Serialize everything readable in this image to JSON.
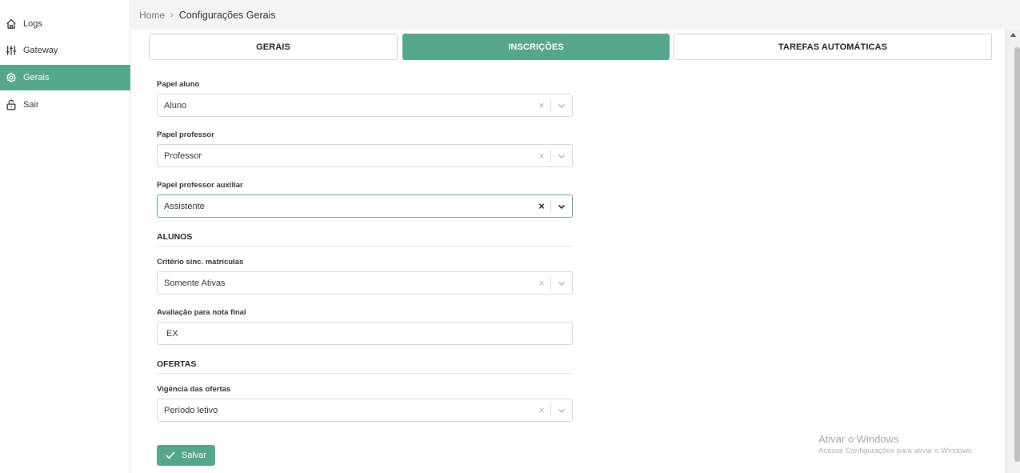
{
  "sidebar": {
    "items": [
      {
        "label": "Logs",
        "icon": "home-icon"
      },
      {
        "label": "Gateway",
        "icon": "sliders-icon"
      },
      {
        "label": "Gerais",
        "icon": "gear-icon",
        "active": true
      },
      {
        "label": "Sair",
        "icon": "lock-open-icon"
      }
    ]
  },
  "breadcrumb": {
    "home": "Home",
    "separator": "›",
    "current": "Configurações Gerais"
  },
  "tabs": [
    {
      "label": "GERAIS"
    },
    {
      "label": "INSCRIÇÕES",
      "active": true
    },
    {
      "label": "TAREFAS AUTOMÁTICAS"
    }
  ],
  "form": {
    "papel_aluno": {
      "label": "Papel aluno",
      "value": "Aluno"
    },
    "papel_professor": {
      "label": "Papel professor",
      "value": "Professor"
    },
    "papel_professor_auxiliar": {
      "label": "Papel professor auxiliar",
      "value": "Assistente"
    },
    "section_alunos": "ALUNOS",
    "criterio_sinc": {
      "label": "Critério sinc. matrículas",
      "value": "Somente Ativas"
    },
    "avaliacao_nota_final": {
      "label": "Avaliação para nota final",
      "value": "EX"
    },
    "section_ofertas": "OFERTAS",
    "vigencia_ofertas": {
      "label": "Vigência das ofertas",
      "value": "Período letivo"
    },
    "save_label": "Salvar"
  },
  "clear_glyph": "×",
  "watermark": {
    "title": "Ativar o Windows",
    "subtitle": "Acesse Configurações para ativar o Windows."
  },
  "colors": {
    "accent": "#56a68a"
  }
}
